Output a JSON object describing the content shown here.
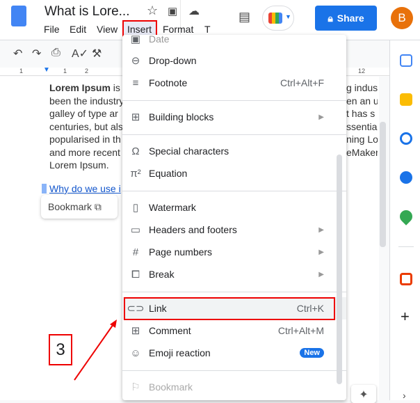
{
  "header": {
    "title": "What is Lore...",
    "share_label": "Share",
    "avatar_letter": "B",
    "menus": [
      "File",
      "Edit",
      "View",
      "Insert",
      "Format",
      "T"
    ]
  },
  "ruler": {
    "ticks": [
      "1",
      "1",
      "2",
      "12"
    ]
  },
  "document": {
    "bold_lead": "Lorem Ipsum",
    "lines": [
      "is",
      "been the industry",
      "galley of type ar",
      "centuries, but als",
      "popularised in th",
      "and more recent",
      "Lorem Ipsum."
    ],
    "right_lines": [
      "g indust",
      "en an ur",
      "t has s",
      "ssential",
      "ning Lor",
      "eMaker",
      ""
    ],
    "heading_link": "Why do we use i",
    "bookmark_chip": "Bookmark"
  },
  "insert_menu": {
    "items": [
      {
        "label": "Date",
        "icon": "calendar-icon"
      },
      {
        "label": "Drop-down",
        "icon": "dropdown-icon"
      },
      {
        "label": "Footnote",
        "shortcut": "Ctrl+Alt+F",
        "icon": "footnote-icon"
      },
      {
        "label": "Building blocks",
        "submenu": true,
        "icon": "building-blocks-icon"
      },
      {
        "label": "Special characters",
        "icon": "omega-icon"
      },
      {
        "label": "Equation",
        "icon": "pi-icon"
      },
      {
        "label": "Watermark",
        "icon": "watermark-icon"
      },
      {
        "label": "Headers and footers",
        "submenu": true,
        "icon": "header-footer-icon"
      },
      {
        "label": "Page numbers",
        "submenu": true,
        "icon": "hash-icon"
      },
      {
        "label": "Break",
        "submenu": true,
        "icon": "break-icon"
      },
      {
        "label": "Link",
        "shortcut": "Ctrl+K",
        "icon": "link-icon",
        "highlighted": true
      },
      {
        "label": "Comment",
        "shortcut": "Ctrl+Alt+M",
        "icon": "comment-icon"
      },
      {
        "label": "Emoji reaction",
        "badge": "New",
        "icon": "emoji-icon"
      },
      {
        "label": "Bookmark",
        "disabled": true,
        "icon": "bookmark-icon"
      }
    ]
  },
  "annotation": {
    "step": "3"
  },
  "colors": {
    "accent": "#1a73e8",
    "highlight": "#ee0000",
    "avatar": "#e8710a"
  }
}
